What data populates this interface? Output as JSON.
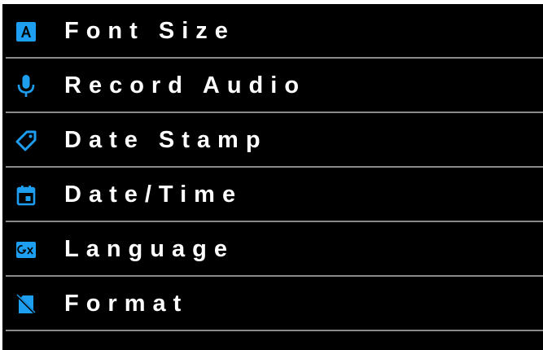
{
  "theme": {
    "background": "#000000",
    "text": "#ffffff",
    "accent": "#1e9ef0",
    "divider": "#8a8a8a"
  },
  "menu": {
    "items": [
      {
        "label": "Font Size",
        "icon": "font-size-icon"
      },
      {
        "label": "Record Audio",
        "icon": "microphone-icon"
      },
      {
        "label": "Date Stamp",
        "icon": "tag-icon"
      },
      {
        "label": "Date/Time",
        "icon": "calendar-icon"
      },
      {
        "label": "Language",
        "icon": "translate-icon"
      },
      {
        "label": "Format",
        "icon": "sd-card-off-icon"
      }
    ]
  }
}
